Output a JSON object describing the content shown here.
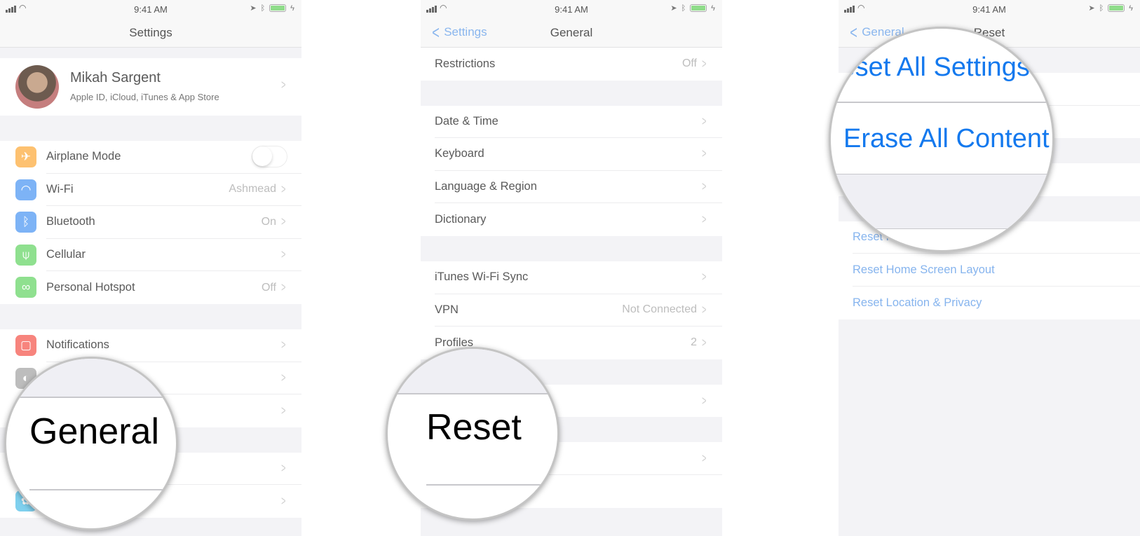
{
  "status_bar": {
    "time": "9:41 AM"
  },
  "colors": {
    "accent_blue": "#1479ee",
    "link_faded": "#86b4ee",
    "battery": "#8fdc8a"
  },
  "panel1": {
    "nav_title": "Settings",
    "profile": {
      "name": "Mikah Sargent",
      "subtitle": "Apple ID, iCloud, iTunes & App Store"
    },
    "groups": [
      [
        {
          "label": "Airplane Mode",
          "icon": "airplane-icon",
          "glyph": "✈",
          "color": "#fdc170",
          "toggle": false
        },
        {
          "label": "Wi-Fi",
          "value": "Ashmead",
          "icon": "wifi-icon",
          "glyph": "◠",
          "color": "#7db3f6"
        },
        {
          "label": "Bluetooth",
          "value": "On",
          "icon": "bluetooth-icon",
          "glyph": "ᛒ",
          "color": "#7db3f6"
        },
        {
          "label": "Cellular",
          "icon": "cellular-icon",
          "glyph": "⍦",
          "color": "#8fe08f"
        },
        {
          "label": "Personal Hotspot",
          "value": "Off",
          "icon": "hotspot-icon",
          "glyph": "∞",
          "color": "#8fe08f"
        }
      ],
      [
        {
          "label": "Notifications",
          "icon": "notifications-icon",
          "glyph": "▢",
          "color": "#f7847d"
        },
        {
          "label": "",
          "icon": "control-center-icon",
          "glyph": "◐",
          "color": "#bdbdbd"
        },
        {
          "label": "",
          "icon": "",
          "glyph": "",
          "color": ""
        }
      ],
      [
        {
          "label": "",
          "icon": "display-icon",
          "glyph": "A",
          "color": "#7db3f6"
        },
        {
          "label": "",
          "icon": "wallpaper-icon",
          "glyph": "✿",
          "color": "#7fd0ee"
        }
      ]
    ],
    "magnifier": {
      "text": "General"
    }
  },
  "panel2": {
    "back_label": "Settings",
    "nav_title": "General",
    "groups": [
      [
        {
          "label": "Restrictions",
          "value": "Off"
        }
      ],
      [
        {
          "label": "Date & Time"
        },
        {
          "label": "Keyboard"
        },
        {
          "label": "Language & Region"
        },
        {
          "label": "Dictionary"
        }
      ],
      [
        {
          "label": "iTunes Wi-Fi Sync"
        },
        {
          "label": "VPN",
          "value": "Not Connected"
        },
        {
          "label": "Profiles",
          "value": "2"
        }
      ],
      [
        {
          "label": ""
        }
      ],
      [
        {
          "label": ""
        },
        {
          "label": "",
          "nochevron": true
        }
      ]
    ],
    "magnifier": {
      "text": "Reset"
    }
  },
  "panel3": {
    "back_label": "General",
    "nav_title": "Reset",
    "groups": [
      [
        {
          "label": "",
          "link": true,
          "nochevron": true
        },
        {
          "label": "",
          "link": true,
          "nochevron": true
        }
      ],
      [
        {
          "label": "",
          "link": true,
          "nochevron": true
        }
      ],
      [
        {
          "label": "Reset Keyboard Dictionary",
          "link": true,
          "nochevron": true
        },
        {
          "label": "Reset Home Screen Layout",
          "link": true,
          "nochevron": true
        },
        {
          "label": "Reset Location & Privacy",
          "link": true,
          "nochevron": true
        }
      ]
    ],
    "magnifier": {
      "line1": "Reset All Settings",
      "line2": "Erase All Content and Settings"
    }
  }
}
